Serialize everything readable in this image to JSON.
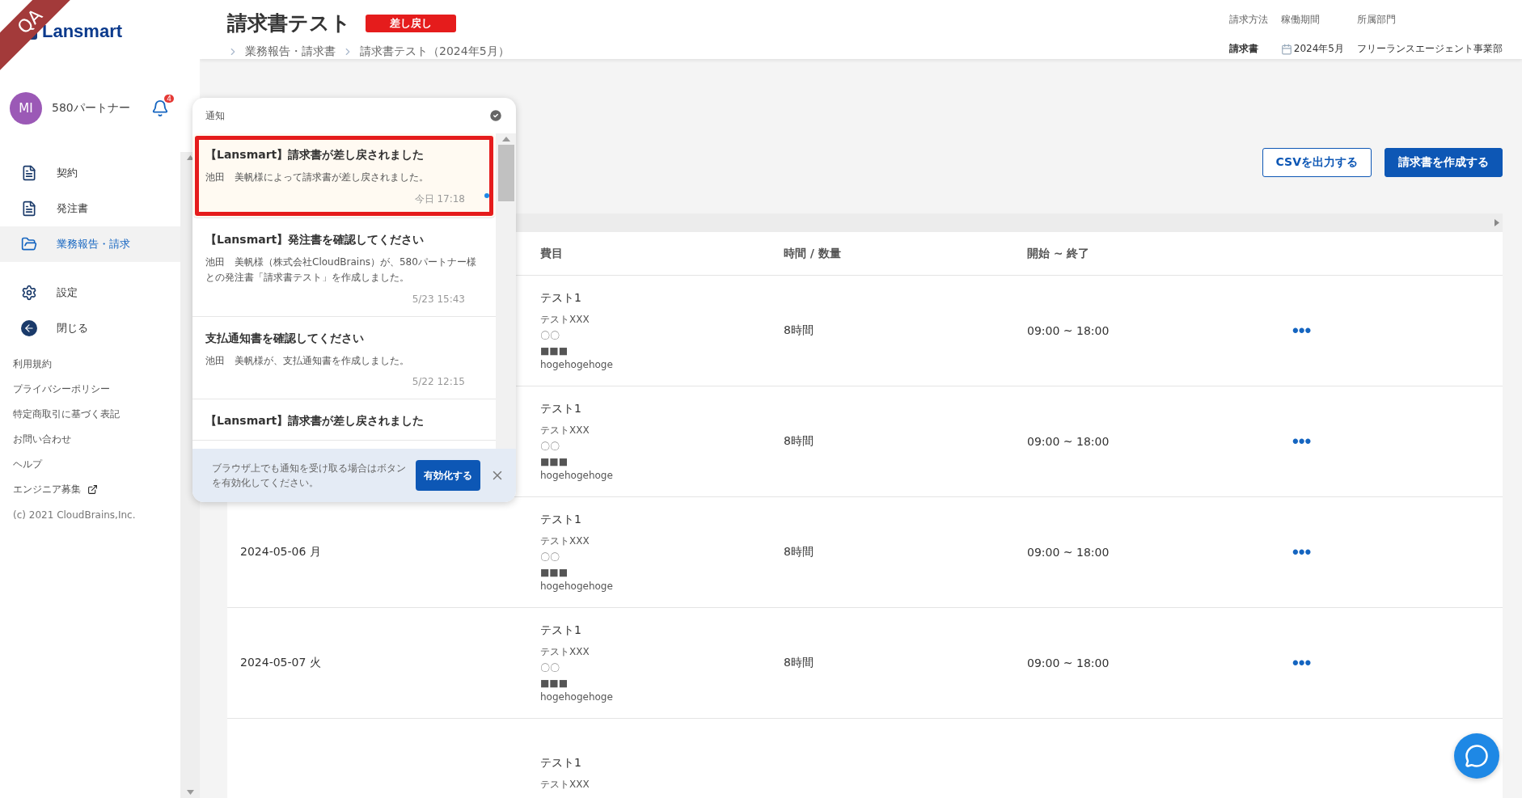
{
  "env_ribbon": "QA",
  "sidebar": {
    "logo": "Lansmart",
    "user": {
      "initials": "MI",
      "name": "580パートナー"
    },
    "notification_count": "4",
    "nav": [
      {
        "label": "契約",
        "kind": "document",
        "selected": false
      },
      {
        "label": "発注書",
        "kind": "document",
        "selected": false
      },
      {
        "label": "業務報告・請求",
        "kind": "folder",
        "selected": true
      },
      {
        "label": "設定",
        "kind": "gear",
        "selected": false
      },
      {
        "label": "閉じる",
        "kind": "back",
        "selected": false
      }
    ],
    "links": [
      {
        "label": "利用規約",
        "external": false
      },
      {
        "label": "プライバシーポリシー",
        "external": false
      },
      {
        "label": "特定商取引に基づく表記",
        "external": false
      },
      {
        "label": "お問い合わせ",
        "external": false
      },
      {
        "label": "ヘルプ",
        "external": false
      },
      {
        "label": "エンジニア募集",
        "external": true
      }
    ],
    "copyright": "(c) 2021 CloudBrains,Inc."
  },
  "header": {
    "title": "請求書テスト",
    "status": "差し戻し",
    "breadcrumbs": [
      "業務報告・請求書",
      "請求書テスト（2024年5月）"
    ],
    "meta": [
      {
        "label": "請求方法",
        "value": "請求書",
        "kind": "text"
      },
      {
        "label": "稼働期間",
        "value": "2024年5月",
        "kind": "date"
      },
      {
        "label": "所属部門",
        "value": "フリーランスエージェント事業部",
        "kind": "text"
      }
    ]
  },
  "actions": [
    {
      "label": "CSVを出力する",
      "kind": "outline"
    },
    {
      "label": "請求書を作成する",
      "kind": "primary"
    }
  ],
  "table": {
    "columns": [
      "",
      "費目",
      "時間 / 数量",
      "開始 ~ 終了",
      ""
    ],
    "rows": [
      {
        "date": "",
        "items": [
          "テスト1",
          "テストXXX",
          "〇〇",
          "■■■",
          "hogehogehoge"
        ],
        "hours": "8時間",
        "time": "09:00 ~ 18:00",
        "menu": "•••"
      },
      {
        "date": "",
        "items": [
          "テスト1",
          "テストXXX",
          "〇〇",
          "■■■",
          "hogehogehoge"
        ],
        "hours": "8時間",
        "time": "09:00 ~ 18:00",
        "menu": "•••"
      },
      {
        "date": "2024-05-06 月",
        "items": [
          "テスト1",
          "テストXXX",
          "〇〇",
          "■■■",
          "hogehogehoge"
        ],
        "hours": "8時間",
        "time": "09:00 ~ 18:00",
        "menu": "•••"
      },
      {
        "date": "2024-05-07 火",
        "items": [
          "テスト1",
          "テストXXX",
          "〇〇",
          "■■■",
          "hogehogehoge"
        ],
        "hours": "8時間",
        "time": "09:00 ~ 18:00",
        "menu": "•••"
      },
      {
        "date": "",
        "items": [
          "テスト1",
          "テストXXX"
        ],
        "hours": "",
        "time": "",
        "menu": ""
      }
    ]
  },
  "notifications": {
    "title": "通知",
    "items": [
      {
        "title": "【Lansmart】請求書が差し戻されました",
        "body": "池田　美帆様によって請求書が差し戻されました。",
        "time": "今日 17:18",
        "unread": true,
        "highlighted": true
      },
      {
        "title": "【Lansmart】発注書を確認してください",
        "body": "池田　美帆様（株式会社CloudBrains）が、580パートナー様との発注書「請求書テスト」を作成しました。",
        "time": "5/23 15:43",
        "unread": false,
        "highlighted": false
      },
      {
        "title": "支払通知書を確認してください",
        "body": "池田　美帆様が、支払通知書を作成しました。",
        "time": "5/22 12:15",
        "unread": false,
        "highlighted": false
      },
      {
        "title": "【Lansmart】請求書が差し戻されました",
        "unread": false,
        "highlighted": false
      }
    ],
    "banner": {
      "text": "ブラウザ上でも通知を受け取る場合はボタンを有効化してください。",
      "button": "有効化する"
    }
  }
}
